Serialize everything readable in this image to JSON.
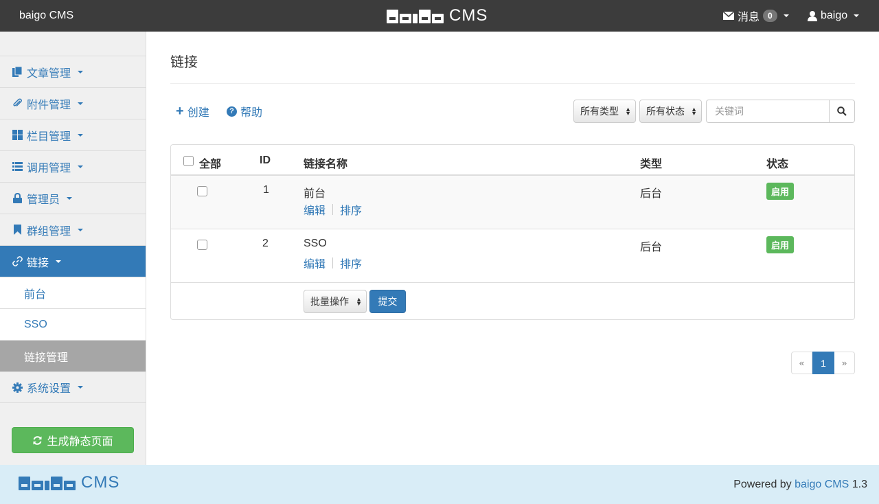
{
  "topbar": {
    "brand": "baigo CMS",
    "logo_text": "CMS",
    "messages_label": "消息",
    "messages_count": "0",
    "user_label": "baigo"
  },
  "sidebar": {
    "items": [
      {
        "label": "文章管理",
        "icon": "document-icon"
      },
      {
        "label": "附件管理",
        "icon": "paperclip-icon"
      },
      {
        "label": "栏目管理",
        "icon": "grid-icon"
      },
      {
        "label": "调用管理",
        "icon": "list-icon"
      },
      {
        "label": "管理员",
        "icon": "lock-icon"
      },
      {
        "label": "群组管理",
        "icon": "bookmark-icon"
      },
      {
        "label": "链接",
        "icon": "link-icon"
      }
    ],
    "sub_items": [
      {
        "label": "前台"
      },
      {
        "label": "SSO"
      },
      {
        "label": "链接管理"
      }
    ],
    "settings_label": "系统设置",
    "generate_button": "生成静态页面"
  },
  "main": {
    "title": "链接",
    "create_label": "创建",
    "help_label": "帮助",
    "type_select": "所有类型",
    "status_select": "所有状态",
    "search_placeholder": "关键词",
    "table": {
      "headers": {
        "all": "全部",
        "id": "ID",
        "name": "链接名称",
        "type": "类型",
        "status": "状态"
      },
      "rows": [
        {
          "id": "1",
          "name": "前台",
          "type": "后台",
          "status": "启用",
          "edit": "编辑",
          "sort": "排序"
        },
        {
          "id": "2",
          "name": "SSO",
          "type": "后台",
          "status": "启用",
          "edit": "编辑",
          "sort": "排序"
        }
      ],
      "batch_select": "批量操作",
      "submit_label": "提交"
    },
    "pagination": {
      "prev": "«",
      "current": "1",
      "next": "»"
    }
  },
  "footer": {
    "logo_text": "CMS",
    "powered_prefix": "Powered by",
    "powered_link": "baigo CMS",
    "version": "1.3"
  },
  "colors": {
    "topbar_bg": "#3c3c3c",
    "primary": "#337ab7",
    "success": "#5cb85c",
    "footer_bg": "#d9edf7"
  }
}
